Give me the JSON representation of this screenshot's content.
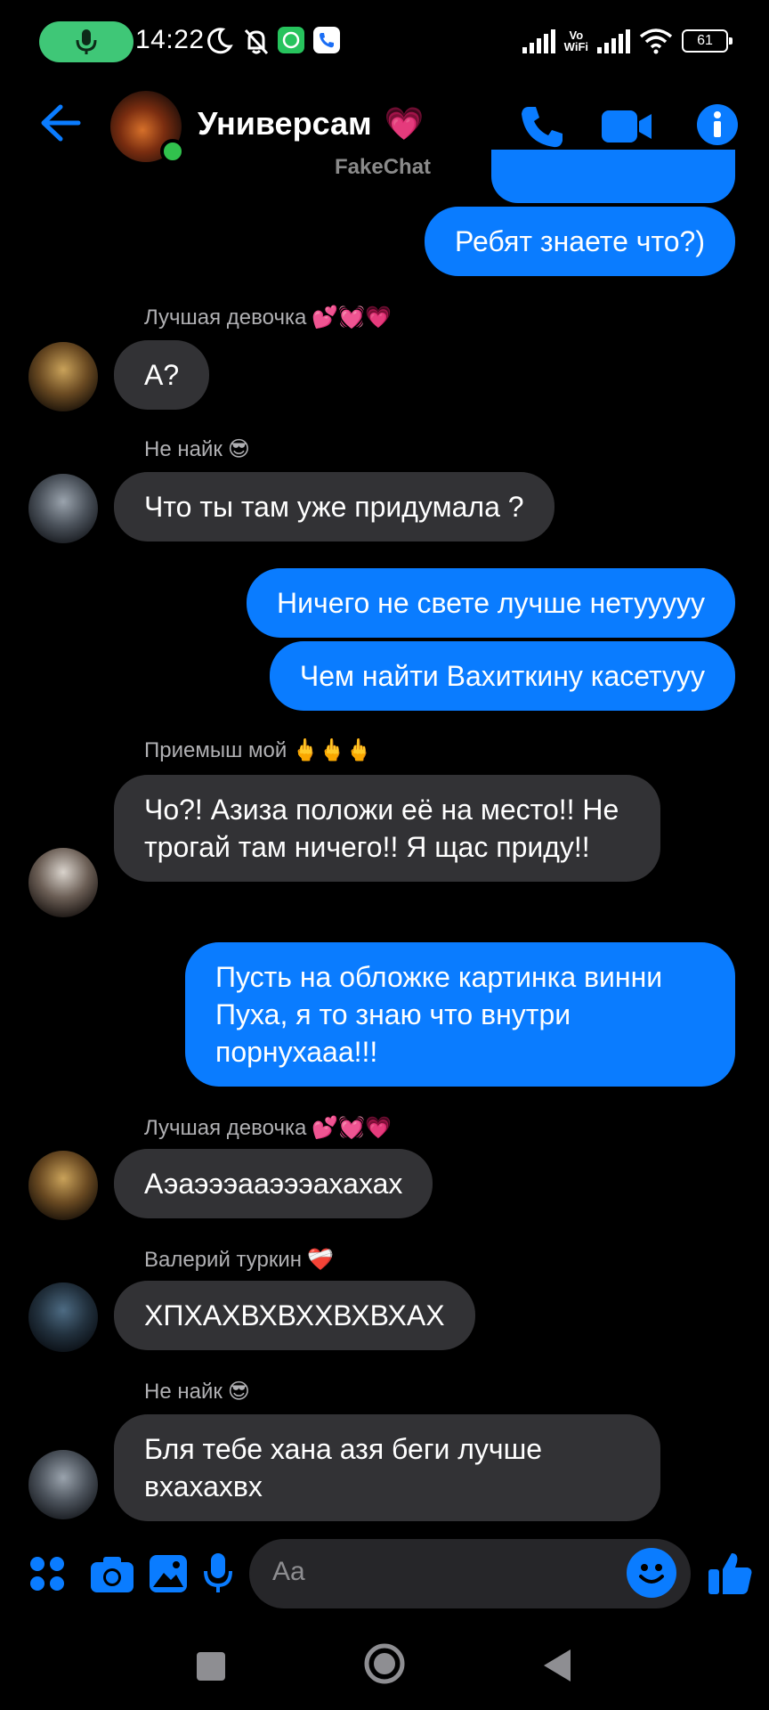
{
  "status_bar": {
    "time": "14:22",
    "battery": "61",
    "vowifi_line1": "Vo",
    "vowifi_line2": "WiFi",
    "icons": [
      "microphone-icon",
      "moon-icon",
      "bell-off-icon",
      "whatsapp-icon",
      "phone-app-icon",
      "signal-icon",
      "wifi-icon",
      "battery-icon"
    ]
  },
  "header": {
    "title": "Универсам",
    "title_emoji": "💗",
    "watermark": "FakeChat",
    "accent": "#0a7cff"
  },
  "messages": [
    {
      "dir": "out",
      "text": "Ребят знаете что?)"
    },
    {
      "dir": "in",
      "sender": "Лучшая девочка",
      "sender_emoji": "💕💓💗",
      "text": "А?"
    },
    {
      "dir": "in",
      "sender": "Не найк",
      "sender_emoji": "😎",
      "text": "Что ты там уже придумала ?"
    },
    {
      "dir": "out",
      "text": "Ничего не свете лучше нетууууу"
    },
    {
      "dir": "out",
      "text": "Чем найти Вахиткину касетууу"
    },
    {
      "dir": "in",
      "sender": "Приемыш мой",
      "sender_emoji": "🖕🖕🖕",
      "text": "Чо?! Азиза положи её на место!! Не трогай там ничего!! Я щас приду!!"
    },
    {
      "dir": "out",
      "text": "Пусть на обложке картинка винни Пуха, я то знаю что внутри порнухааа!!!"
    },
    {
      "dir": "in",
      "sender": "Лучшая девочка",
      "sender_emoji": "💕💓💗",
      "text": "Аэаэээааэээахахах"
    },
    {
      "dir": "in",
      "sender": "Валерий туркин",
      "sender_emoji": "❤️‍🩹",
      "text": "ХПХАХВХВХХВХВХАХ"
    },
    {
      "dir": "in",
      "sender": "Не найк",
      "sender_emoji": "😎",
      "text": "Бля тебе хана азя беги лучше вхахахвх"
    }
  ],
  "composer": {
    "placeholder": "Aa"
  }
}
